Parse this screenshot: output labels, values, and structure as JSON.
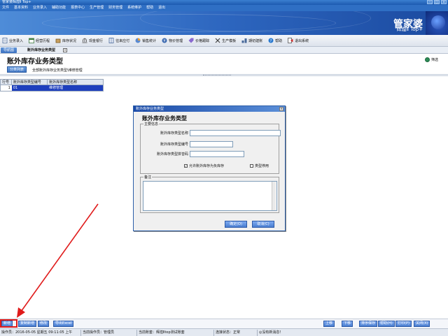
{
  "window": {
    "title": "管家婆辉煌Ⅱ Top+",
    "controls": [
      "–",
      "□",
      "×"
    ]
  },
  "menu": {
    "items": [
      "文件",
      "基本资料",
      "业务录入",
      "辅助功能",
      "报表中心",
      "生产管理",
      "财务管理",
      "系统维护",
      "帮助",
      "退出"
    ]
  },
  "banner": {
    "brand": "管家婆",
    "edition": "辉煌Ⅱ Top+"
  },
  "toolbar": {
    "items": [
      {
        "label": "业务录入",
        "icon": "document-icon"
      },
      {
        "label": "经营历程",
        "icon": "calendar-icon"
      },
      {
        "label": "库存状况",
        "icon": "box-icon"
      },
      {
        "label": "现金银行",
        "icon": "bank-icon"
      },
      {
        "label": "往来应付",
        "icon": "ledger-icon"
      },
      {
        "label": "销售统计",
        "icon": "chart-icon"
      },
      {
        "label": "物价管理",
        "icon": "price-icon"
      },
      {
        "label": "价格跟踪",
        "icon": "tag-icon"
      },
      {
        "label": "生产模板",
        "icon": "tools-icon"
      },
      {
        "label": "期初建账",
        "icon": "setup-icon"
      },
      {
        "label": "帮助",
        "icon": "help-icon"
      },
      {
        "label": "退出系统",
        "icon": "exit-icon"
      }
    ]
  },
  "tabs": {
    "nav": "导航图",
    "document": "账外库存业务类型",
    "close": "×"
  },
  "page": {
    "title": "账外库存业务类型",
    "filter": "筛选",
    "category_button": "分类列表",
    "breadcrumb": "全部账外库存业务类型\\维修管理"
  },
  "grid": {
    "headers": [
      "行号",
      "账外库存类型编号",
      "账外库存类型名称"
    ],
    "rows": [
      {
        "num": "1",
        "code": "01",
        "name": "维修管理"
      }
    ]
  },
  "dialog": {
    "title": "账外库存业务类型",
    "heading": "账外库存业务类型",
    "group_main": "主要信息",
    "fields": [
      {
        "label": "账外库存类型名称",
        "value": ""
      },
      {
        "label": "账外库存类型编号",
        "value": ""
      },
      {
        "label": "账外库存类型拼音码",
        "value": ""
      }
    ],
    "checkbox_stock": "允许账外库存为负库存",
    "checkbox_stock_checked": "✓",
    "checkbox_disabled": "类型停用",
    "group_note": "备注",
    "note_value": "",
    "ok_button": "确定(O)",
    "cancel_button": "取消(C)"
  },
  "bottom_buttons": {
    "left": [
      "新增",
      "复制新增",
      "修改",
      "导出Excel"
    ],
    "right": [
      "上移",
      "下移",
      "排序保存",
      "帮助(H)",
      "打印(P)",
      "关闭(X)"
    ]
  },
  "status": {
    "operator": "操作员：2016-05-05 星期五 09:11:05 上午",
    "company": "当前操作员：管理员",
    "account": "当前账套：辉煌Ⅱtop测试账套",
    "state": "连接状态：正常",
    "message": "◎没有新消息！"
  },
  "colors": {
    "banner": "#2d66bf",
    "selection": "#1e3fbd",
    "annotation": "#e01b1b"
  }
}
